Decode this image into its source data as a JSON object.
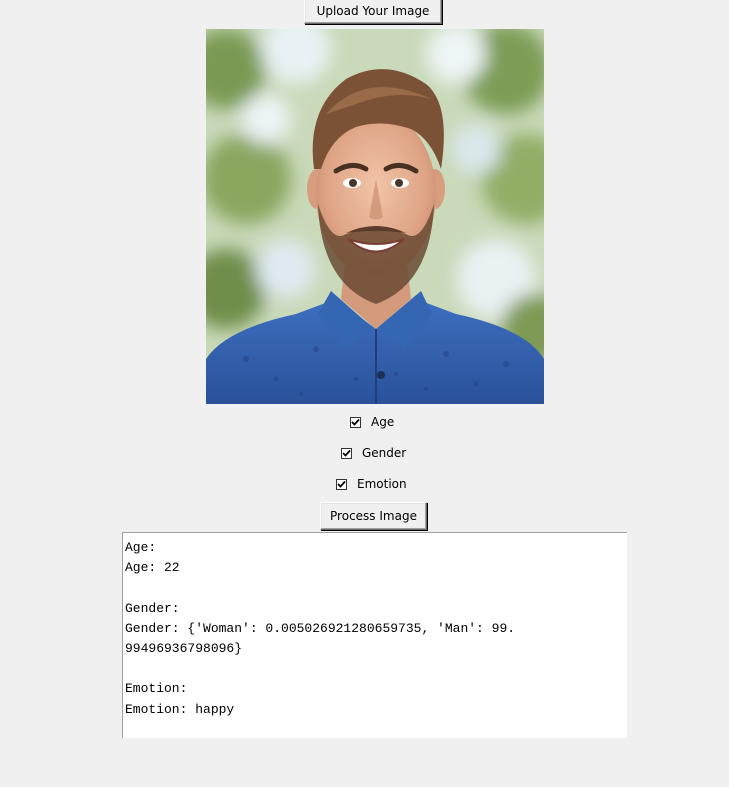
{
  "toolbar": {
    "upload_label": "Upload Your Image"
  },
  "photo": {
    "subject": "smiling young man with beard in blue denim shirt"
  },
  "options": {
    "age": {
      "label": "Age",
      "checked": true
    },
    "gender": {
      "label": "Gender",
      "checked": true
    },
    "emotion": {
      "label": "Emotion",
      "checked": true
    }
  },
  "actions": {
    "process_label": "Process Image"
  },
  "results": {
    "lines": [
      "Age:",
      "Age: 22",
      "",
      "Gender:",
      "Gender: {'Woman': 0.005026921280659735, 'Man': 99.",
      "99496936798096}",
      "",
      "Emotion:",
      "Emotion: happy"
    ]
  }
}
